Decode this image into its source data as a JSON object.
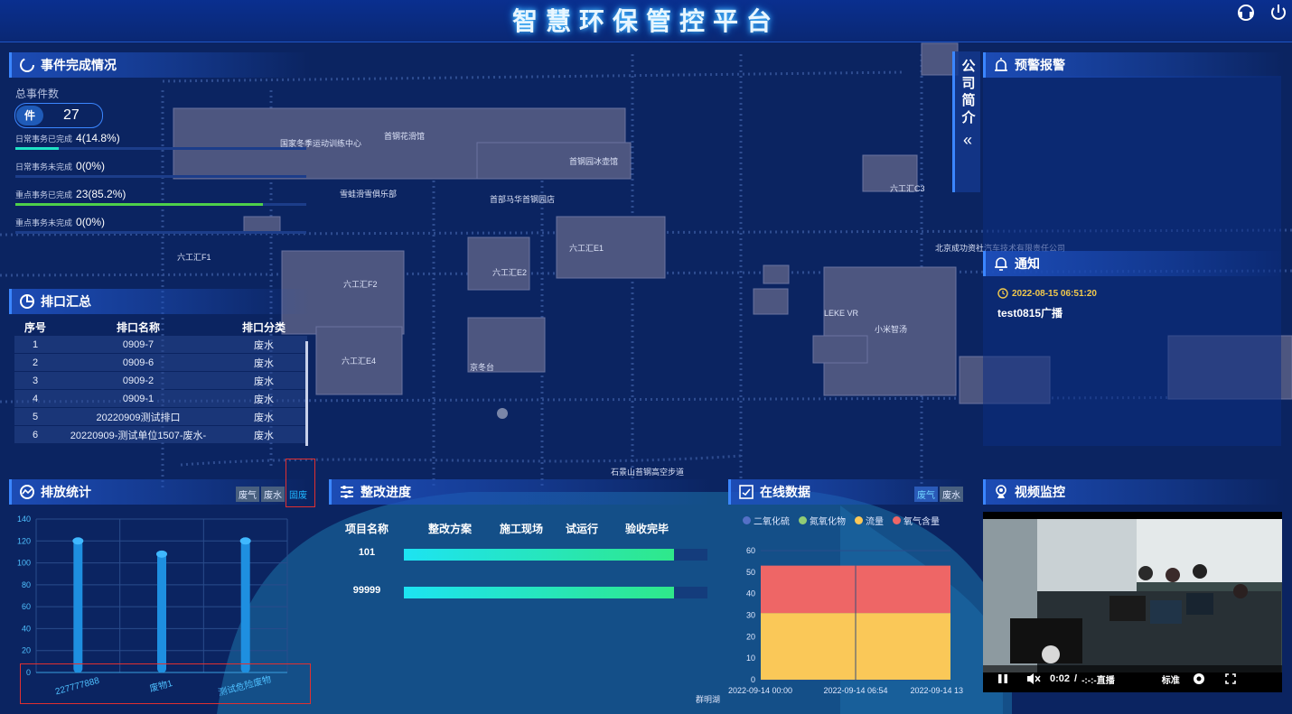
{
  "header": {
    "title": "智慧环保管控平台"
  },
  "map_labels": [
    "首钢花滑馆",
    "首钢园冰壶馆",
    "六工汇E1",
    "六工汇F2",
    "六工汇E2",
    "六工汇E4",
    "六工汇F1",
    "六工汇C3",
    "小米智汤",
    "北京成功资社汽车技术有限责任公司",
    "首部马华首钢园店",
    "雪蛙滑雪俱乐部",
    "国家冬季运动训练中心",
    "石景山苔钢高空步道",
    "京冬台",
    "LEKE VR",
    "群明湖"
  ],
  "events": {
    "title": "事件完成情况",
    "total_label": "总事件数",
    "unit": "件",
    "total": "27",
    "items": [
      {
        "label": "日常事务已完成",
        "value": "4(14.8%)",
        "percent": 14.8,
        "color": "#1ee3c6"
      },
      {
        "label": "日常事务未完成",
        "value": "0(0%)",
        "percent": 0,
        "color": "#1ee3c6"
      },
      {
        "label": "重点事务已完成",
        "value": "23(85.2%)",
        "percent": 85.2,
        "color": "#4ed14a"
      },
      {
        "label": "重点事务未完成",
        "value": "0(0%)",
        "percent": 0,
        "color": "#4ed14a"
      }
    ]
  },
  "outfall": {
    "title": "排口汇总",
    "headers": [
      "序号",
      "排口名称",
      "排口分类"
    ],
    "rows": [
      [
        "1",
        "0909-7",
        "废水"
      ],
      [
        "2",
        "0909-6",
        "废水"
      ],
      [
        "3",
        "0909-2",
        "废水"
      ],
      [
        "4",
        "0909-1",
        "废水"
      ],
      [
        "5",
        "20220909测试排口",
        "废水"
      ],
      [
        "6",
        "20220909-测试单位1507-废水-",
        "废水"
      ]
    ]
  },
  "emission": {
    "title": "排放统计",
    "tabs": [
      "废气",
      "废水",
      "固废"
    ],
    "active_tab": "固废"
  },
  "rectify": {
    "title": "整改进度",
    "headers": [
      "项目名称",
      "整改方案",
      "施工现场",
      "试运行",
      "验收完毕"
    ],
    "rows": [
      {
        "name": "101",
        "progress": 0.89
      },
      {
        "name": "99999",
        "progress": 0.89
      }
    ]
  },
  "online": {
    "title": "在线数据",
    "tabs": [
      "废气",
      "废水"
    ],
    "active_tab": "废气",
    "legend": [
      {
        "name": "二氧化硫",
        "color": "#5470c6"
      },
      {
        "name": "氮氧化物",
        "color": "#91cc75"
      },
      {
        "name": "流量",
        "color": "#fac858"
      },
      {
        "name": "氧气含量",
        "color": "#ee6666"
      }
    ]
  },
  "company": {
    "label": "公司简介",
    "arrow": "«"
  },
  "alarm": {
    "title": "预警报警"
  },
  "notice": {
    "title": "通知",
    "time": "2022-08-15 06:51:20",
    "content": "test0815广播"
  },
  "video": {
    "title": "视频监控",
    "time": "0:02",
    "separator": "/",
    "live": "-:-:-直播",
    "quality": "标准"
  },
  "chart_data": [
    {
      "type": "bar",
      "categories": [
        "227777888",
        "废物1",
        "测试危险废物"
      ],
      "values": [
        120,
        108,
        120
      ],
      "ylim": [
        0,
        140
      ],
      "yticks": [
        0,
        20,
        40,
        60,
        80,
        100,
        120,
        140
      ],
      "color": "#1e8fe0"
    },
    {
      "type": "area",
      "x": [
        "2022-09-14 00:00",
        "2022-09-14 06:54",
        "2022-09-14 13"
      ],
      "ylim": [
        0,
        60
      ],
      "yticks": [
        0,
        10,
        20,
        30,
        40,
        50,
        60
      ],
      "series": [
        {
          "name": "二氧化硫",
          "values": [
            0,
            0,
            0
          ]
        },
        {
          "name": "氮氧化物",
          "values": [
            0,
            0,
            0
          ]
        },
        {
          "name": "流量",
          "values": [
            31,
            31,
            31
          ]
        },
        {
          "name": "氧气含量",
          "values": [
            22,
            22,
            22
          ]
        }
      ]
    }
  ]
}
